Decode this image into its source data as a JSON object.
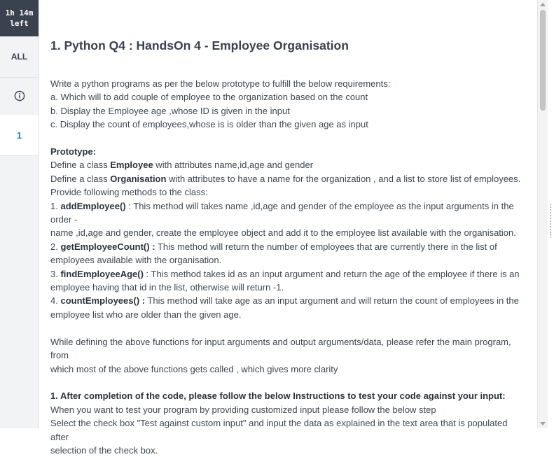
{
  "timer": {
    "line1": "1h 14m",
    "line2": "left"
  },
  "nav": {
    "all_label": "ALL",
    "info_icon": "info-circle-icon",
    "question_label": "1"
  },
  "question": {
    "title": "1. Python Q4 : HandsOn 4 - Employee Organisation",
    "intro": [
      "Write a python programs as per the below prototype to fulfill the below requirements:",
      "a. Which will to add couple of employee to the organization based on the count",
      "b. Display the Employee age ,whose ID is given in the input",
      "c. Display the count of employees,whose is is older than the given age as input"
    ],
    "prototype_heading": "Prototype:",
    "employee_line": {
      "pre": "Define a class ",
      "bold": "Employee",
      "post": " with attributes name,id,age and gender"
    },
    "organisation_line": {
      "pre": "Define a class ",
      "bold": "Organisation",
      "post": " with attributes to have a name for the organization , and a list to store list of employees."
    },
    "methods_intro": "Provide following methods to the class:",
    "methods": [
      {
        "prefix": " 1. ",
        "name": "addEmployee()",
        "line1": " : This method will takes name ,id,age and gender of the employee as the input arguments in the order -",
        "line2": "name ,id,age and gender, create the employee object and add it to the employee list available with the organisation."
      },
      {
        "prefix": "2. ",
        "name": "getEmployeeCount() :",
        "line1": "  This method will return the number of employees that are currently there in the list of",
        "line2": "employees available with the organisation."
      },
      {
        "prefix": "3. ",
        "name": "findEmployeeAge()",
        "line1": "  : This method takes id as an input argument  and return the age of the employee if there is an",
        "line2": "employee having that id in the list, otherwise will return -1."
      },
      {
        "prefix": "4. ",
        "name": "countEmployees() :",
        "line1": "   This method will take age as an input argument and will return the count of employees in the",
        "line2": "employee list who are older than the given age."
      }
    ],
    "defining_note": [
      "While defining the above functions for input arguments and output arguments/data, please refer the main program, from",
      "which most of the  above functions gets called , which gives more clarity"
    ],
    "instructions_heading": "1. After completion of the code,  please follow the below Instructions to test your code against your input:",
    "instructions": [
      "When you want to test your program by providing customized input please follow the below step",
      "Select the check box \"Test against custom input\" and input the data as explained in the text area that is populated after",
      "selection of the check box."
    ]
  }
}
